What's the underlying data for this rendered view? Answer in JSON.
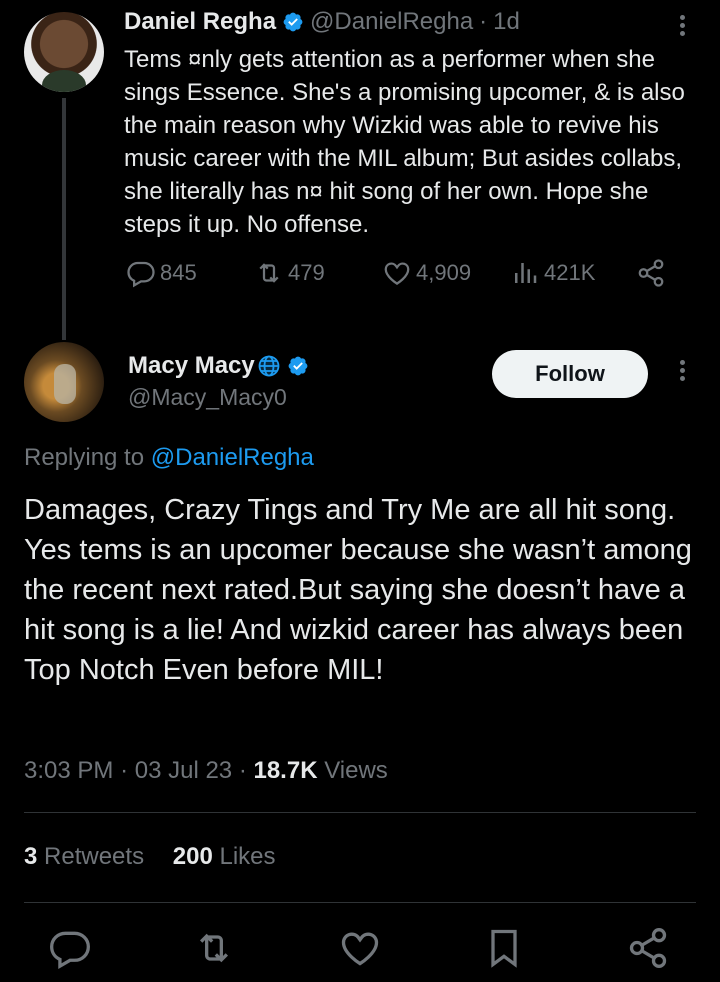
{
  "parent_tweet": {
    "author_name": "Daniel Regha",
    "handle": "@DanielRegha",
    "separator": "·",
    "time": "1d",
    "text": "Tems ¤nly gets attention as a performer when she sings Essence. She's a promising upcomer, & is also the main reason why Wizkid was able to revive his music career with the MIL album; But asides collabs, she literally has n¤ hit song of her own. Hope she steps it up. No offense.",
    "replies": "845",
    "retweets": "479",
    "likes": "4,909",
    "views": "421K"
  },
  "reply_tweet": {
    "author_name": "Macy Macy",
    "handle": "@Macy_Macy0",
    "follow_label": "Follow",
    "replying_prefix": "Replying to",
    "replying_handle": "@DanielRegha",
    "text": "Damages, Crazy Tings and Try Me are all hit song. Yes tems is an upcomer because she wasn’t among the recent next rated.But saying she doesn’t have a hit song is a lie! And wizkid career has always been Top Notch Even before MIL!",
    "time": "3:03 PM",
    "date": "03 Jul 23",
    "separator": "·",
    "views_count": "18.7K",
    "views_label": "Views",
    "retweets_count": "3",
    "retweets_label": "Retweets",
    "likes_count": "200",
    "likes_label": "Likes"
  },
  "icons": [
    "reply-icon",
    "retweet-icon",
    "like-icon",
    "views-icon",
    "share-icon",
    "bookmark-icon",
    "verified-icon",
    "globe-icon",
    "more-icon"
  ],
  "colors": {
    "background": "#000000",
    "text": "#e7e9ea",
    "muted": "#71767b",
    "link": "#1d9bf0",
    "verified": "#1d9bf0",
    "follow_bg": "#eff3f4"
  }
}
